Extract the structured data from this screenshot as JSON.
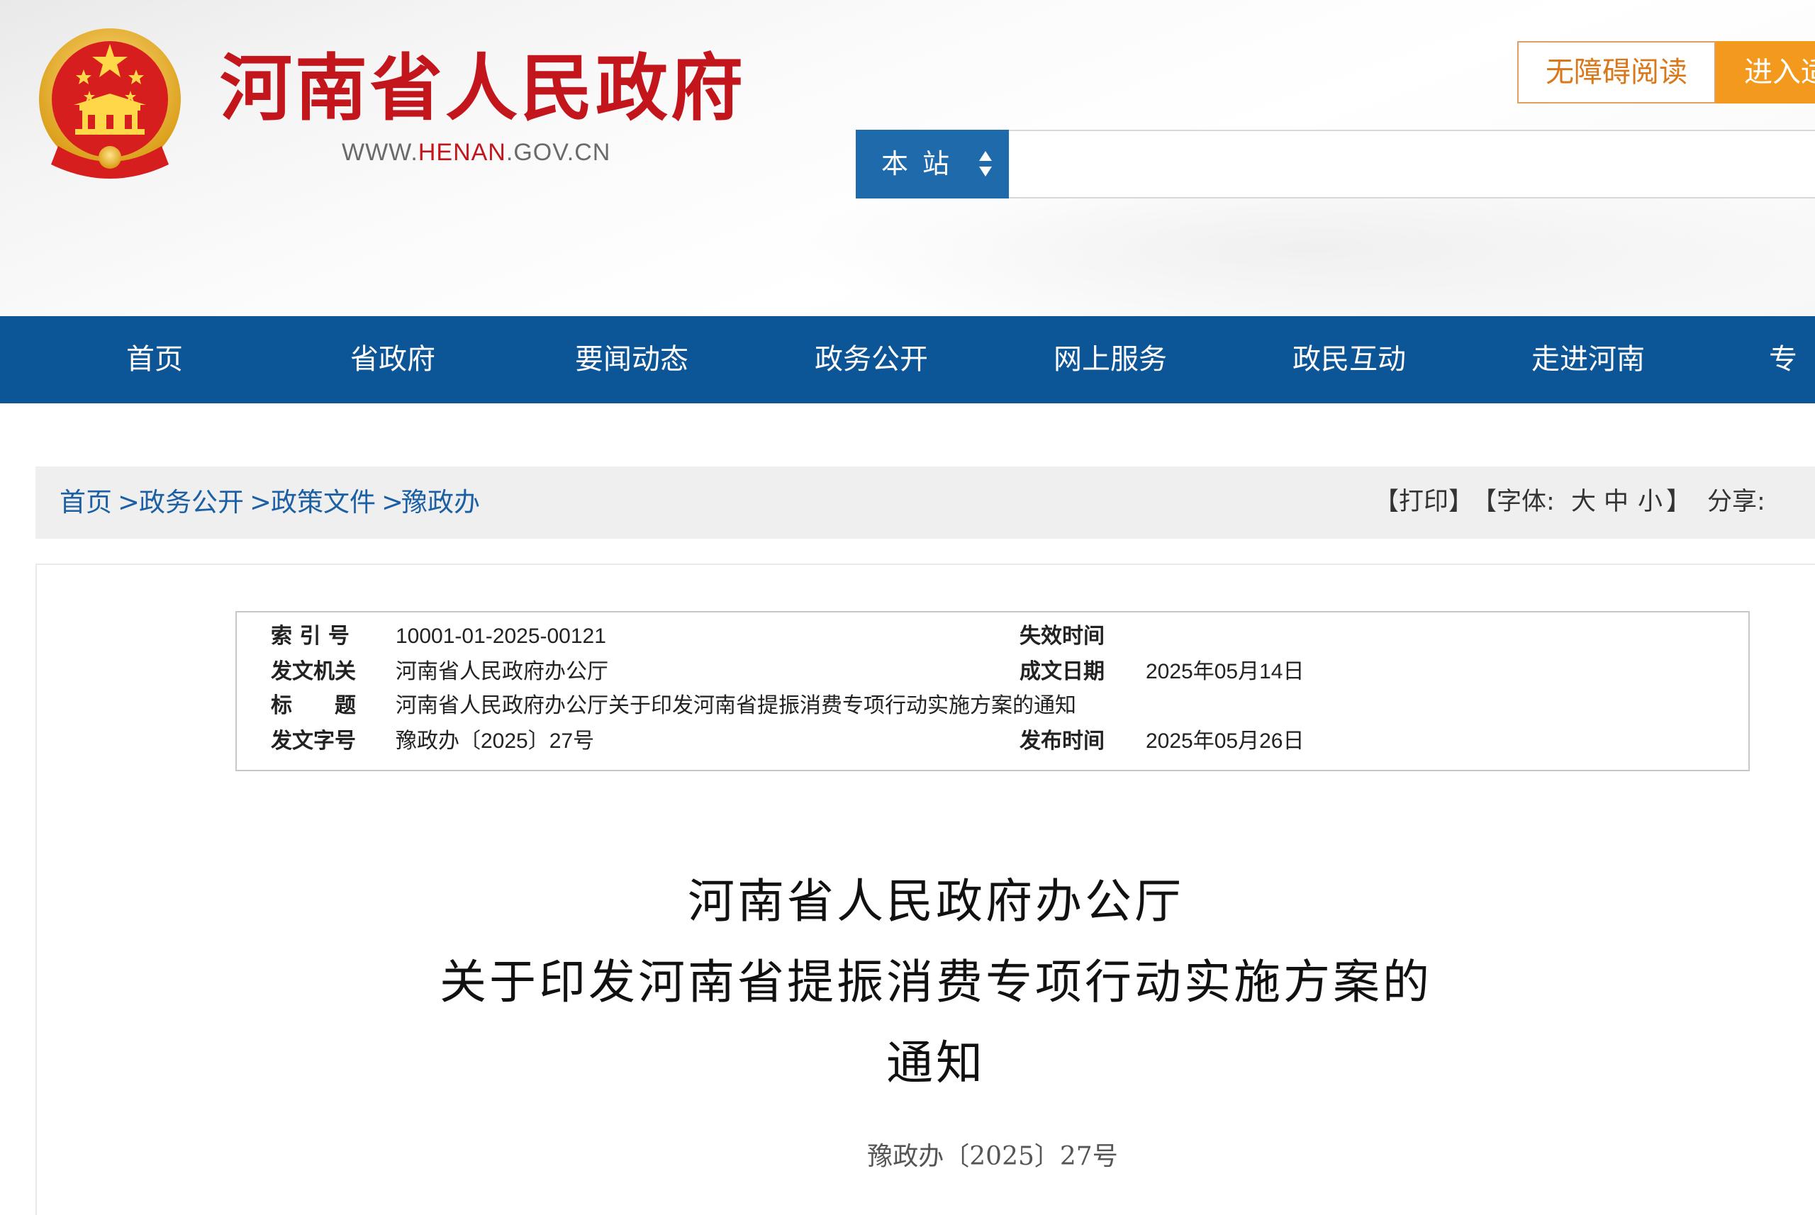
{
  "header": {
    "site_title": "河南省人民政府",
    "domain_prefix": "WWW.",
    "domain_highlight": "HENAN",
    "domain_suffix": ".GOV.CN",
    "accessibility_label": "无障碍阅读",
    "enter_label": "进入适"
  },
  "search": {
    "scope_label": "本站",
    "query": ""
  },
  "nav": {
    "items": [
      "首页",
      "省政府",
      "要闻动态",
      "政务公开",
      "网上服务",
      "政民互动",
      "走进河南",
      "专题"
    ]
  },
  "breadcrumb": {
    "items": [
      "首页",
      "政务公开",
      "政策文件",
      "豫政办"
    ],
    "separator": ">"
  },
  "tools": {
    "print": "【打印】",
    "font_prefix": "【字体:",
    "font_large": "大",
    "font_medium": "中",
    "font_small": "小",
    "font_suffix": "】",
    "share": "分享:"
  },
  "meta": {
    "index_label": "索 引 号",
    "index_value": "10001-01-2025-00121",
    "expiry_label": "失效时间",
    "expiry_value": "",
    "issuer_label": "发文机关",
    "issuer_value": "河南省人民政府办公厅",
    "written_label": "成文日期",
    "written_value": "2025年05月14日",
    "title_label": "标　　题",
    "title_value": "河南省人民政府办公厅关于印发河南省提振消费专项行动实施方案的通知",
    "docno_label": "发文字号",
    "docno_value": "豫政办〔2025〕27号",
    "publish_label": "发布时间",
    "publish_value": "2025年05月26日"
  },
  "document": {
    "title_line1": "河南省人民政府办公厅",
    "title_line2": "关于印发河南省提振消费专项行动实施方案的",
    "title_line3": "通知",
    "number": "豫政办〔2025〕27号"
  },
  "colors": {
    "brand_red": "#c3161c",
    "nav_blue": "#0c5597",
    "search_blue": "#1e6aab",
    "link_blue": "#1c5fa3",
    "accent_orange": "#f39a1e",
    "wechat_green": "#2db54a"
  },
  "icons": {
    "emblem": "national-emblem-icon",
    "scope_arrows": "sort-arrows-icon",
    "wechat": "wechat-icon"
  }
}
